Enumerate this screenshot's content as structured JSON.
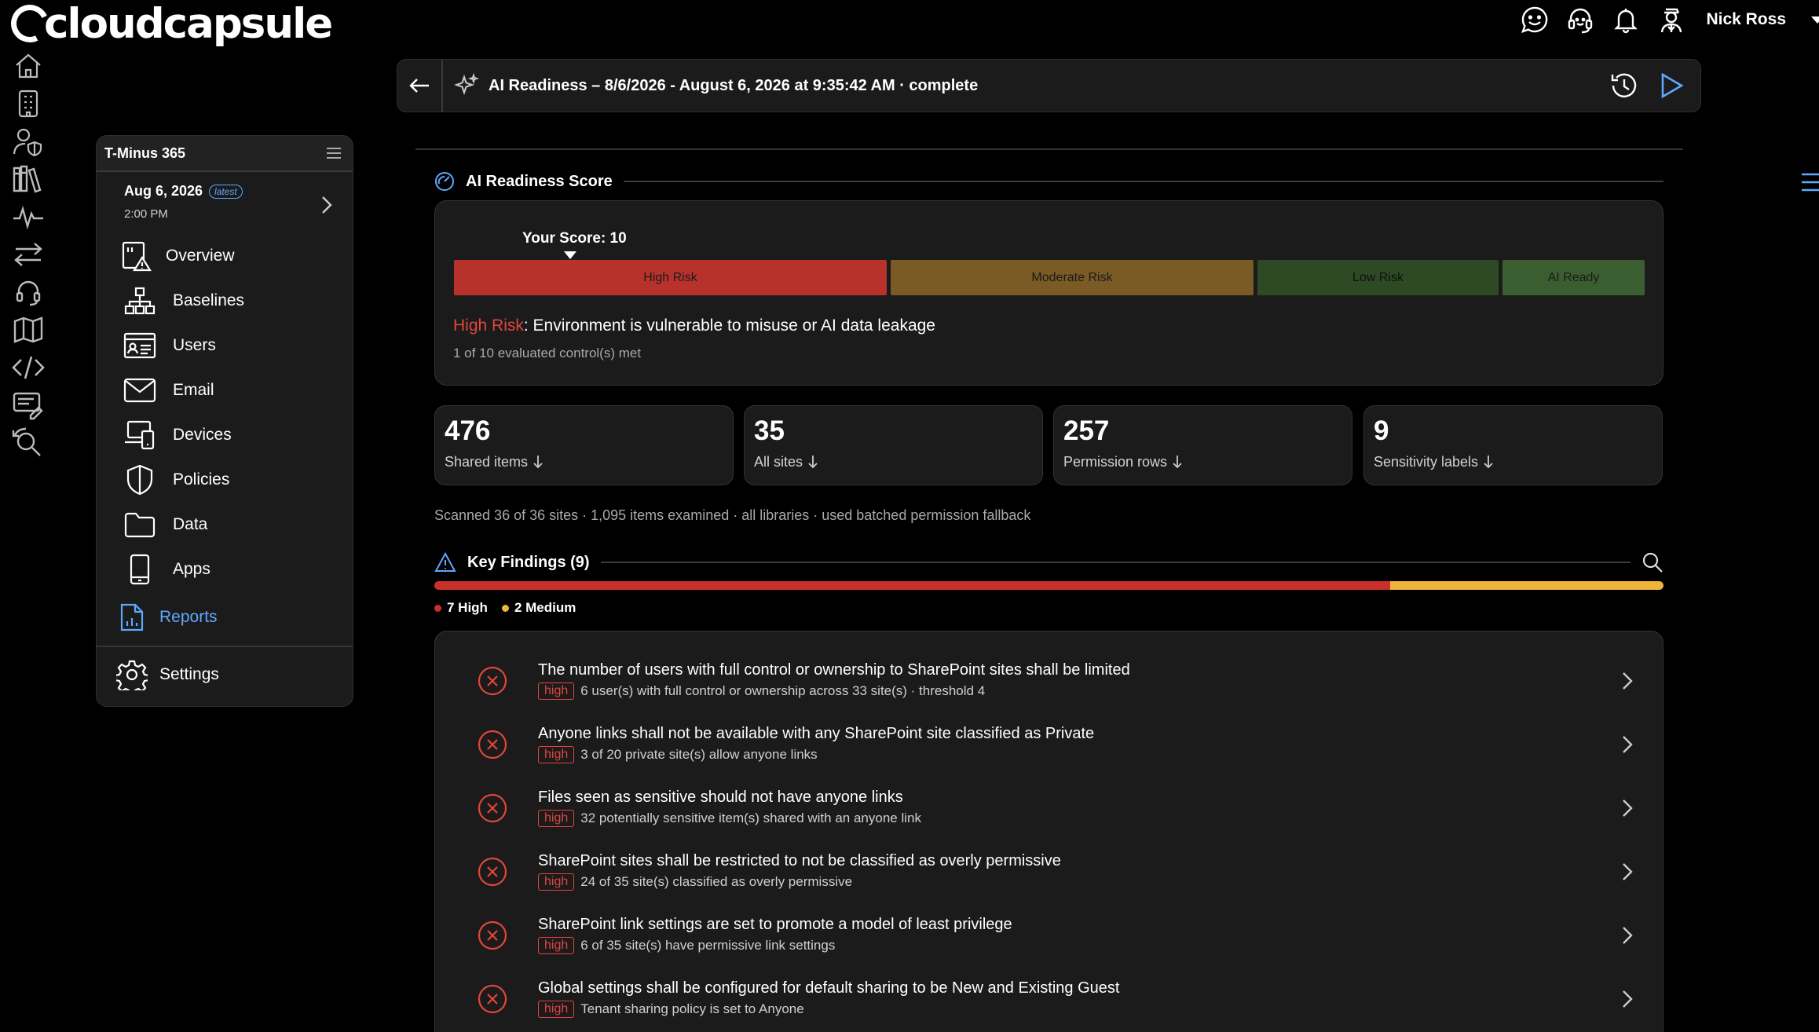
{
  "app": {
    "brand": "cloudcapsule",
    "accent": "#5ea8ff"
  },
  "topbar": {
    "icons": [
      "chat-smile-icon",
      "headset-icon",
      "bell-icon",
      "user-icon"
    ],
    "user_name": "Nick Ross"
  },
  "rail": {
    "icons": [
      "home-icon",
      "building-icon",
      "user-shield-icon",
      "library-icon",
      "pulse-icon",
      "transfer-icon",
      "headset-icon",
      "map-icon",
      "code-icon",
      "edit-list-icon",
      "search-refresh-icon"
    ]
  },
  "sidemenu": {
    "title": "T-Minus 365",
    "date": "Aug 6, 2026",
    "badge": "latest",
    "time": "2:00 PM",
    "items": [
      {
        "label": "Overview",
        "icon": "overview-alert-icon"
      },
      {
        "label": "Baselines",
        "icon": "hierarchy-icon"
      },
      {
        "label": "Users",
        "icon": "id-card-icon"
      },
      {
        "label": "Email",
        "icon": "envelope-icon"
      },
      {
        "label": "Devices",
        "icon": "devices-icon"
      },
      {
        "label": "Policies",
        "icon": "shield-icon"
      },
      {
        "label": "Data",
        "icon": "folder-icon"
      },
      {
        "label": "Apps",
        "icon": "phone-icon"
      }
    ],
    "reports_label": "Reports",
    "settings_label": "Settings"
  },
  "header": {
    "title": "AI Readiness – 8/6/2026 - August 6, 2026 at 9:35:42 AM · complete"
  },
  "score": {
    "section_title": "AI Readiness Score",
    "your_score": "Your Score: 10",
    "segments": [
      {
        "label": "High Risk",
        "bg": "#b8322c",
        "fg": "#1a1a1a"
      },
      {
        "label": "Moderate Risk",
        "bg": "#7a5a25",
        "fg": "#1a1a1a"
      },
      {
        "label": "Low Risk",
        "bg": "#2e4a24",
        "fg": "#0f0f0f"
      },
      {
        "label": "AI Ready",
        "bg": "#3b5e30",
        "fg": "#1a1a1a"
      }
    ],
    "risk_label": "High Risk",
    "risk_desc": ": Environment is vulnerable to misuse or AI data leakage",
    "met": "1 of 10 evaluated control(s) met"
  },
  "stats": [
    {
      "value": "476",
      "label": "Shared items"
    },
    {
      "value": "35",
      "label": "All sites"
    },
    {
      "value": "257",
      "label": "Permission rows"
    },
    {
      "value": "9",
      "label": "Sensitivity labels"
    }
  ],
  "scanned": "Scanned 36 of 36 sites · 1,095 items examined · all libraries · used batched permission fallback",
  "findings": {
    "section_title": "Key Findings (9)",
    "high_count": 7,
    "medium_count": 2,
    "legend_high": "7 High",
    "legend_medium": "2 Medium",
    "colors": {
      "high": "#c9302c",
      "medium": "#f0b43c"
    },
    "items": [
      {
        "title": "The number of users with full control or ownership to SharePoint sites shall be limited",
        "severity": "high",
        "detail": "6 user(s) with full control or ownership across 33 site(s) · threshold 4"
      },
      {
        "title": "Anyone links shall not be available with any SharePoint site classified as Private",
        "severity": "high",
        "detail": "3 of 20 private site(s) allow anyone links"
      },
      {
        "title": "Files seen as sensitive should not have anyone links",
        "severity": "high",
        "detail": "32 potentially sensitive item(s) shared with an anyone link"
      },
      {
        "title": "SharePoint sites shall be restricted to not be classified as overly permissive",
        "severity": "high",
        "detail": "24 of 35 site(s) classified as overly permissive"
      },
      {
        "title": "SharePoint link settings are set to promote a model of least privilege",
        "severity": "high",
        "detail": "6 of 35 site(s) have permissive link settings"
      },
      {
        "title": "Global settings shall be configured for default sharing to be New and Existing Guest",
        "severity": "high",
        "detail": "Tenant sharing policy is set to Anyone"
      }
    ]
  }
}
